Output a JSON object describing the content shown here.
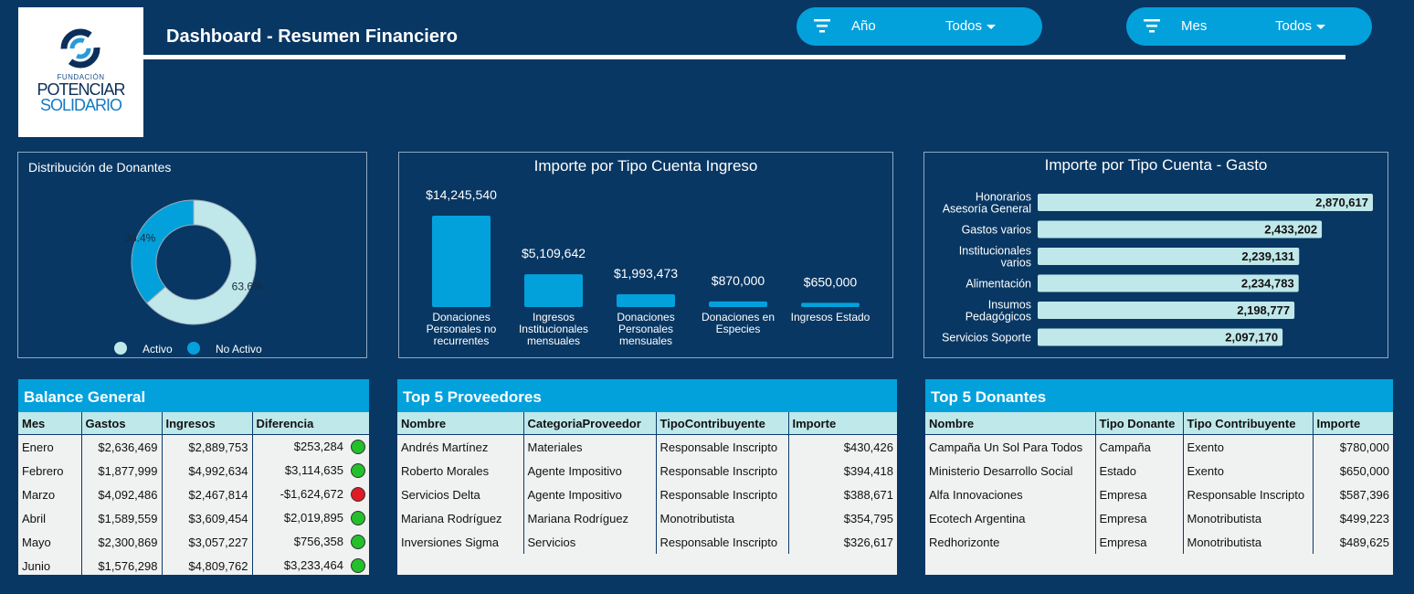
{
  "header": {
    "title": "Dashboard - Resumen Financiero",
    "logo": {
      "line1": "FUNDACIÓN",
      "line2": "POTENCIAR",
      "line3": "SOLIDARIO"
    }
  },
  "filters": [
    {
      "label": "Año",
      "value": "Todos"
    },
    {
      "label": "Mes",
      "value": "Todos"
    }
  ],
  "colors": {
    "background": "#083763",
    "accent": "#03a1dc",
    "light": "#c0e8ea",
    "ok": "#22c02a",
    "bad": "#e01b24"
  },
  "donut": {
    "title": "Distribución de Donantes",
    "slices": [
      {
        "name": "Activo",
        "value": 63.6,
        "label": "63.6%",
        "color": "#c0e8ea"
      },
      {
        "name": "No Activo",
        "value": 36.4,
        "label": "36.4%",
        "color": "#03a1dc"
      }
    ]
  },
  "chart_data": [
    {
      "type": "bar",
      "title": "Importe por Tipo Cuenta Ingreso",
      "categories": [
        "Donaciones Personales no recurrentes",
        "Ingresos Institucionales mensuales",
        "Donaciones Personales mensuales",
        "Donaciones en Especies",
        "Ingresos Estado"
      ],
      "values": [
        14245540,
        5109642,
        1993473,
        870000,
        650000
      ],
      "value_labels": [
        "$14,245,540",
        "$5,109,642",
        "$1,993,473",
        "$870,000",
        "$650,000"
      ],
      "category_lines": [
        [
          "Donaciones",
          "Personales no",
          "recurrentes"
        ],
        [
          "Ingresos",
          "Institucionales",
          "mensuales"
        ],
        [
          "Donaciones",
          "Personales",
          "mensuales"
        ],
        [
          "Donaciones en",
          "Especies"
        ],
        [
          "Ingresos Estado"
        ]
      ]
    },
    {
      "type": "bar",
      "orientation": "horizontal",
      "title": "Importe por Tipo Cuenta - Gasto",
      "categories": [
        "Honorarios Asesoría General",
        "Gastos varios",
        "Institucionales varios",
        "Alimentación",
        "Insumos Pedagógicos",
        "Servicios Soporte"
      ],
      "values": [
        2870617,
        2433202,
        2239131,
        2234783,
        2198777,
        2097170
      ],
      "value_labels": [
        "2,870,617",
        "2,433,202",
        "2,239,131",
        "2,234,783",
        "2,198,777",
        "2,097,170"
      ],
      "category_lines": [
        [
          "Honorarios",
          "Asesoría General"
        ],
        [
          "Gastos varios"
        ],
        [
          "Institucionales",
          "varios"
        ],
        [
          "Alimentación"
        ],
        [
          "Insumos",
          "Pedagógicos"
        ],
        [
          "Servicios Soporte"
        ]
      ]
    }
  ],
  "balance": {
    "title": "Balance General",
    "columns": [
      "Mes",
      "Gastos",
      "Ingresos",
      "Diferencia"
    ],
    "rows": [
      {
        "cells": [
          "Enero",
          "$2,636,469",
          "$2,889,753",
          "$253,284"
        ],
        "status": "ok"
      },
      {
        "cells": [
          "Febrero",
          "$1,877,999",
          "$4,992,634",
          "$3,114,635"
        ],
        "status": "ok"
      },
      {
        "cells": [
          "Marzo",
          "$4,092,486",
          "$2,467,814",
          "-$1,624,672"
        ],
        "status": "bad"
      },
      {
        "cells": [
          "Abril",
          "$1,589,559",
          "$3,609,454",
          "$2,019,895"
        ],
        "status": "ok"
      },
      {
        "cells": [
          "Mayo",
          "$2,300,869",
          "$3,057,227",
          "$756,358"
        ],
        "status": "ok"
      },
      {
        "cells": [
          "Junio",
          "$1,576,298",
          "$4,809,762",
          "$3,233,464"
        ],
        "status": "ok"
      }
    ]
  },
  "proveedores": {
    "title": "Top 5 Proveedores",
    "columns": [
      "Nombre",
      "CategoriaProveedor",
      "TipoContribuyente",
      "Importe"
    ],
    "rows": [
      [
        "Andrés Martínez",
        "Materiales",
        "Responsable Inscripto",
        "$430,426"
      ],
      [
        "Roberto Morales",
        "Agente Impositivo",
        "Responsable Inscripto",
        "$394,418"
      ],
      [
        "Servicios Delta",
        "Agente Impositivo",
        "Responsable Inscripto",
        "$388,671"
      ],
      [
        "Mariana Rodríguez",
        "Mariana Rodríguez",
        "Monotributista",
        "$354,795"
      ],
      [
        "Inversiones Sigma",
        "Servicios",
        "Responsable Inscripto",
        "$326,617"
      ]
    ]
  },
  "donantes": {
    "title": "Top 5 Donantes",
    "columns": [
      "Nombre",
      "Tipo Donante",
      "Tipo Contribuyente",
      "Importe"
    ],
    "rows": [
      [
        "Campaña Un Sol Para Todos",
        "Campaña",
        "Exento",
        "$780,000"
      ],
      [
        "Ministerio Desarrollo Social",
        "Estado",
        "Exento",
        "$650,000"
      ],
      [
        "Alfa Innovaciones",
        "Empresa",
        "Responsable Inscripto",
        "$587,396"
      ],
      [
        "Ecotech Argentina",
        "Empresa",
        "Monotributista",
        "$499,223"
      ],
      [
        "Redhorizonte",
        "Empresa",
        "Monotributista",
        "$489,625"
      ]
    ]
  }
}
